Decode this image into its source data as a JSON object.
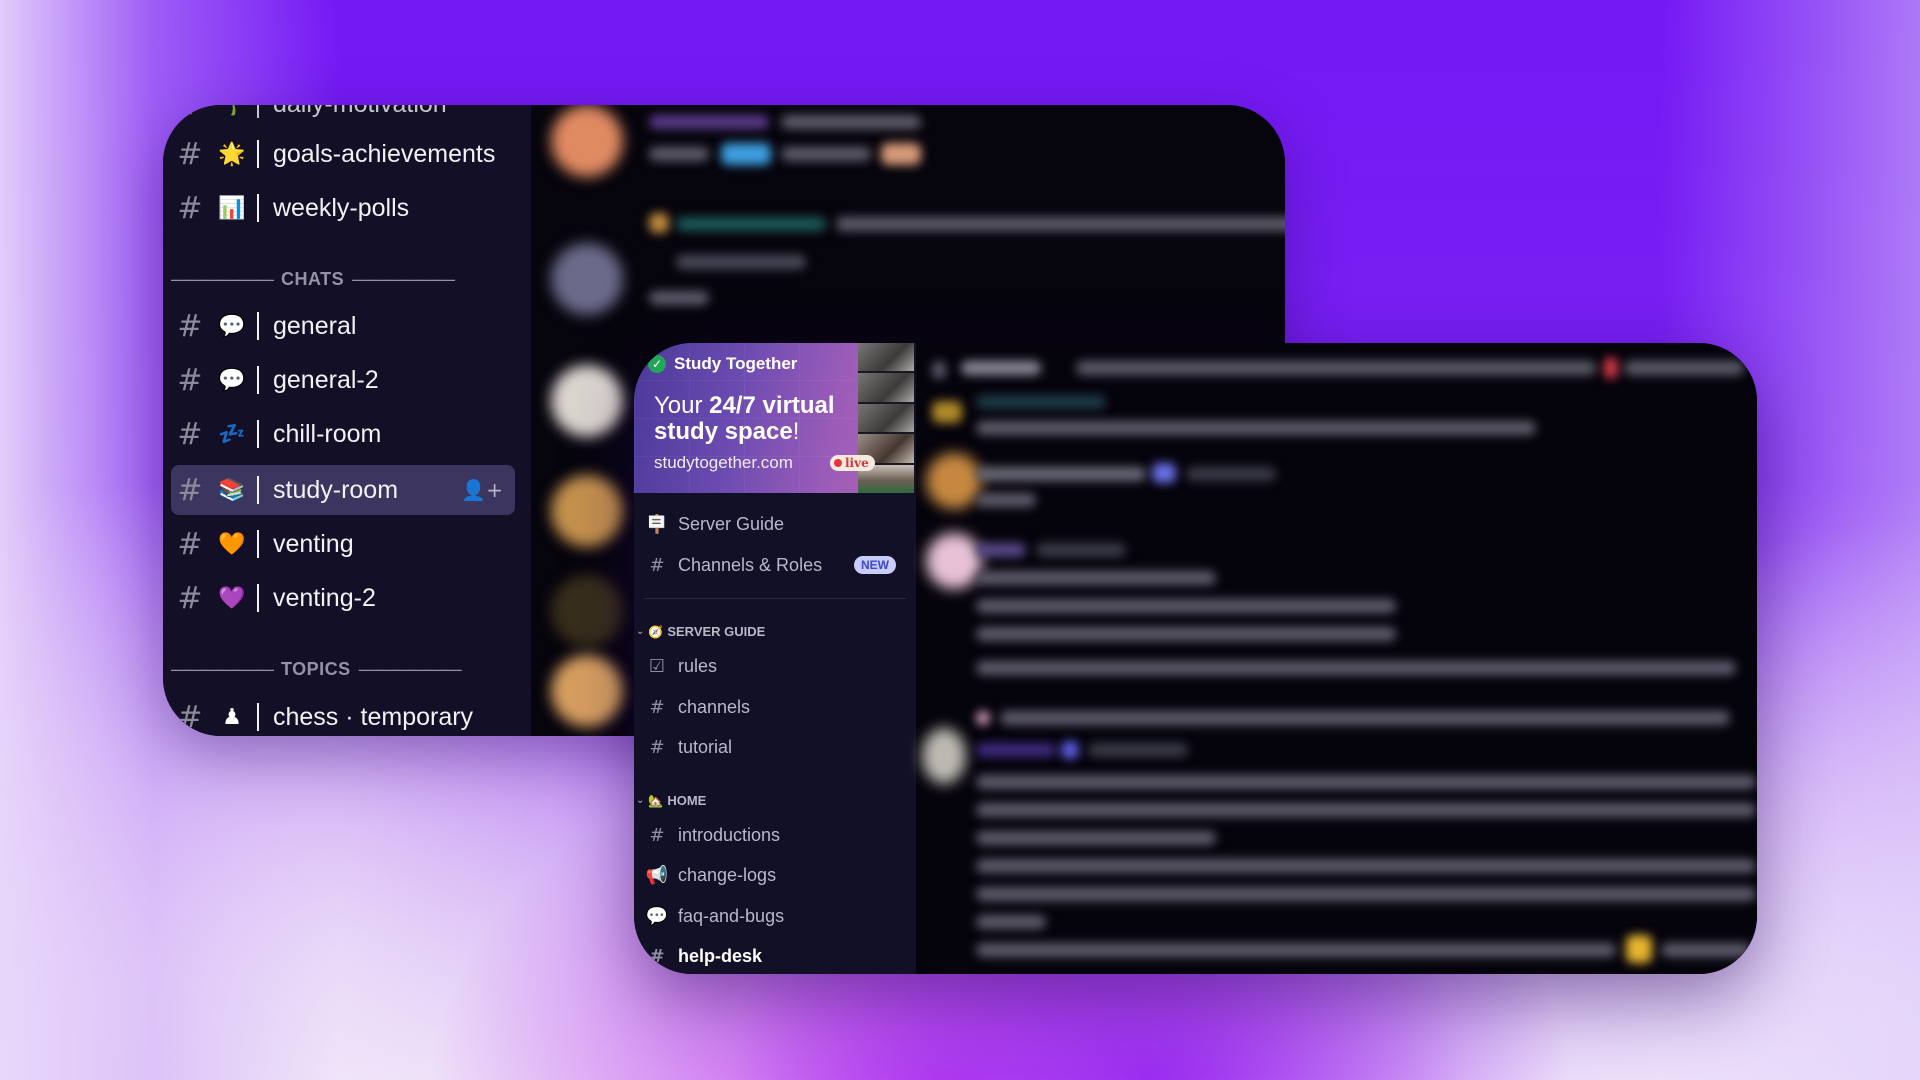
{
  "back_card": {
    "channels": [
      {
        "id": "daily-motivation",
        "icon": "sprout-icon",
        "emoji": "🌱",
        "label": "daily-motivation",
        "type": "text",
        "partial": true
      },
      {
        "id": "goals-achievements",
        "icon": "star-icon",
        "emoji": "🌟",
        "label": "goals-achievements",
        "type": "text"
      },
      {
        "id": "weekly-polls",
        "icon": "bar-chart-icon",
        "emoji": "📊",
        "label": "weekly-polls",
        "type": "forum"
      },
      {
        "id": "general",
        "icon": "speech-bubble-icon",
        "emoji": "💬",
        "label": "general",
        "type": "text"
      },
      {
        "id": "general-2",
        "icon": "speech-bubble-icon",
        "emoji": "💬",
        "label": "general-2",
        "type": "text"
      },
      {
        "id": "chill-room",
        "icon": "zzz-icon",
        "emoji": "💤",
        "label": "chill-room",
        "type": "text"
      },
      {
        "id": "study-room",
        "icon": "books-icon",
        "emoji": "📚",
        "label": "study-room",
        "type": "text",
        "active": true
      },
      {
        "id": "venting",
        "icon": "orange-heart-icon",
        "emoji": "🧡",
        "label": "venting",
        "type": "text"
      },
      {
        "id": "venting-2",
        "icon": "purple-heart-icon",
        "emoji": "💜",
        "label": "venting-2",
        "type": "text"
      },
      {
        "id": "chess",
        "icon": "pawn-icon",
        "emoji": "♟",
        "label": "chess · temporary",
        "type": "text"
      }
    ],
    "sections": {
      "chats": "CHATS",
      "topics": "TOPICS",
      "dash": "——————"
    },
    "hash_glyph": "#",
    "forum_glyph": "#",
    "add_member_glyph": "👤+"
  },
  "front_card": {
    "banner": {
      "server_name": "Study Together",
      "verified_glyph": "✓",
      "tagline_pre": "Your ",
      "tagline_bold": "24/7 virtual study space",
      "tagline_post": "!",
      "url": "studytogether.com",
      "live_label": "live"
    },
    "nav": [
      {
        "label": "Server Guide",
        "icon": "signpost-icon",
        "glyph": "🪧"
      },
      {
        "label": "Channels & Roles",
        "icon": "channel-browse-icon",
        "glyph": "#",
        "badge": "NEW"
      }
    ],
    "categories": [
      {
        "label": "SERVER GUIDE",
        "emoji": "🧭",
        "channels": [
          {
            "label": "rules",
            "icon": "rules-checkbox-icon",
            "glyph": "☑"
          },
          {
            "label": "channels",
            "icon": "hash-icon",
            "glyph": "#"
          },
          {
            "label": "tutorial",
            "icon": "hash-icon",
            "glyph": "#"
          }
        ]
      },
      {
        "label": "HOME",
        "emoji": "🏡",
        "channels": [
          {
            "label": "introductions",
            "icon": "forum-icon",
            "glyph": "#"
          },
          {
            "label": "change-logs",
            "icon": "megaphone-icon",
            "glyph": "📢"
          },
          {
            "label": "faq-and-bugs",
            "icon": "threads-icon",
            "glyph": "💬"
          },
          {
            "label": "help-desk",
            "icon": "forum-icon",
            "glyph": "#",
            "unread": true
          }
        ]
      }
    ],
    "chevron_glyph": "⌄"
  }
}
